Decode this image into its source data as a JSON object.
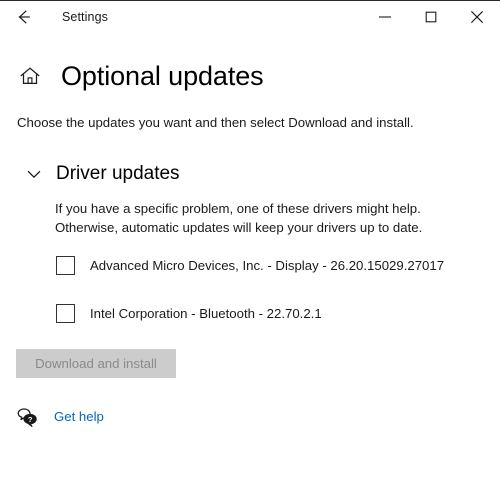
{
  "window": {
    "title": "Settings",
    "back_icon": "back-arrow-icon",
    "controls": {
      "minimize_icon": "minimize-icon",
      "maximize_icon": "maximize-icon",
      "close_icon": "close-icon"
    }
  },
  "page": {
    "home_icon": "home-icon",
    "title": "Optional updates",
    "subtitle": "Choose the updates you want and then select Download and install."
  },
  "section": {
    "chevron_icon": "chevron-down-icon",
    "title": "Driver updates",
    "expanded": true,
    "description": "If you have a specific problem, one of these drivers might help. Otherwise, automatic updates will keep your drivers up to date.",
    "description_line1": "If you have a specific problem, one of these drivers might help.",
    "description_line2": "Otherwise, automatic updates will keep your drivers up to date.",
    "items": [
      {
        "label": "Advanced Micro Devices, Inc. - Display - 26.20.15029.27017",
        "checked": false
      },
      {
        "label": "Intel Corporation - Bluetooth - 22.70.2.1",
        "checked": false
      }
    ]
  },
  "actions": {
    "download_label": "Download and install",
    "download_enabled": false
  },
  "help": {
    "icon": "help-bubble-icon",
    "label": "Get help"
  },
  "colors": {
    "accent_link": "#0067c0",
    "button_disabled_bg": "#cccccc",
    "button_disabled_text": "#8a8a8a",
    "text_primary": "#1a1a1a",
    "checkbox_border": "#333333",
    "window_bg": "#ffffff"
  }
}
